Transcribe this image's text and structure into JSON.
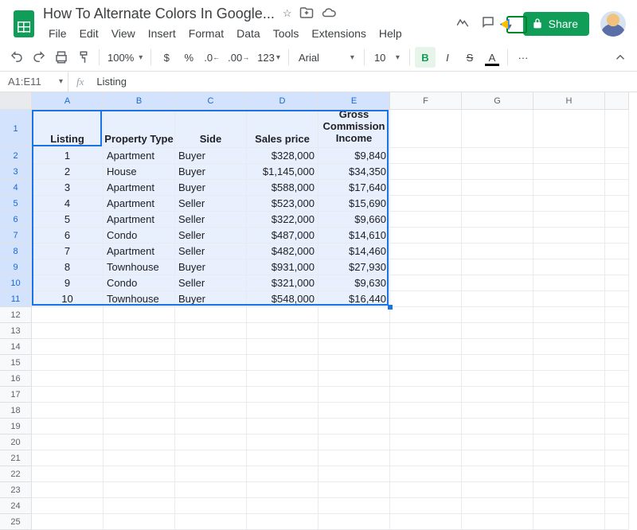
{
  "doc": {
    "title": "How To Alternate Colors In Google..."
  },
  "menus": [
    "File",
    "Edit",
    "View",
    "Insert",
    "Format",
    "Data",
    "Tools",
    "Extensions",
    "Help"
  ],
  "share": {
    "label": "Share"
  },
  "toolbar": {
    "zoom": "100%",
    "fmt123": "123",
    "font": "Arial",
    "fontsize": "10",
    "more": "···"
  },
  "namebox": "A1:E11",
  "fx_value": "Listing",
  "columns": [
    "A",
    "B",
    "C",
    "D",
    "E",
    "F",
    "G",
    "H"
  ],
  "row_numbers": [
    1,
    2,
    3,
    4,
    5,
    6,
    7,
    8,
    9,
    10,
    11,
    12,
    13,
    14,
    15,
    16,
    17,
    18,
    19,
    20,
    21,
    22,
    23,
    24,
    25
  ],
  "headers": {
    "A": "Listing",
    "B": "Property Type",
    "C": "Side",
    "D": "Sales price",
    "E": "Gross Commission Income"
  },
  "rows": [
    {
      "listing": "1",
      "type": "Apartment",
      "side": "Buyer",
      "price": "$328,000",
      "gci": "$9,840"
    },
    {
      "listing": "2",
      "type": "House",
      "side": "Buyer",
      "price": "$1,145,000",
      "gci": "$34,350"
    },
    {
      "listing": "3",
      "type": "Apartment",
      "side": "Buyer",
      "price": "$588,000",
      "gci": "$17,640"
    },
    {
      "listing": "4",
      "type": "Apartment",
      "side": "Seller",
      "price": "$523,000",
      "gci": "$15,690"
    },
    {
      "listing": "5",
      "type": "Apartment",
      "side": "Seller",
      "price": "$322,000",
      "gci": "$9,660"
    },
    {
      "listing": "6",
      "type": "Condo",
      "side": "Seller",
      "price": "$487,000",
      "gci": "$14,610"
    },
    {
      "listing": "7",
      "type": "Apartment",
      "side": "Seller",
      "price": "$482,000",
      "gci": "$14,460"
    },
    {
      "listing": "8",
      "type": "Townhouse",
      "side": "Buyer",
      "price": "$931,000",
      "gci": "$27,930"
    },
    {
      "listing": "9",
      "type": "Condo",
      "side": "Seller",
      "price": "$321,000",
      "gci": "$9,630"
    },
    {
      "listing": "10",
      "type": "Townhouse",
      "side": "Buyer",
      "price": "$548,000",
      "gci": "$16,440"
    }
  ]
}
